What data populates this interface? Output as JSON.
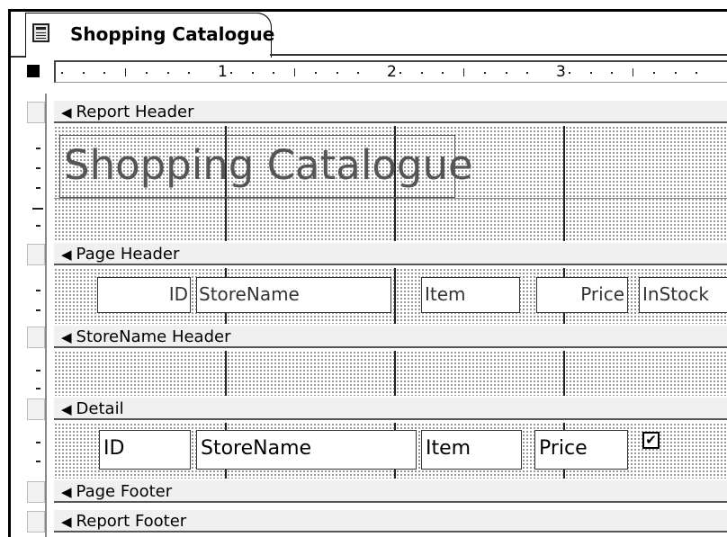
{
  "tab": {
    "title": "Shopping Catalogue",
    "icon": "report-icon"
  },
  "ruler": {
    "numbers": [
      "1",
      "2",
      "3"
    ]
  },
  "sections": {
    "report_header": "Report Header",
    "page_header": "Page Header",
    "storename_header": "StoreName Header",
    "detail": "Detail",
    "page_footer": "Page Footer",
    "report_footer": "Report Footer"
  },
  "report_header_controls": {
    "title": "Shopping Catalogue"
  },
  "page_header_controls": {
    "id": "ID",
    "storename": "StoreName",
    "item": "Item",
    "price": "Price",
    "instock": "InStock"
  },
  "detail_controls": {
    "id": "ID",
    "storename": "StoreName",
    "item": "Item",
    "price": "Price",
    "instock_checked": true,
    "checkmark": "✔"
  }
}
